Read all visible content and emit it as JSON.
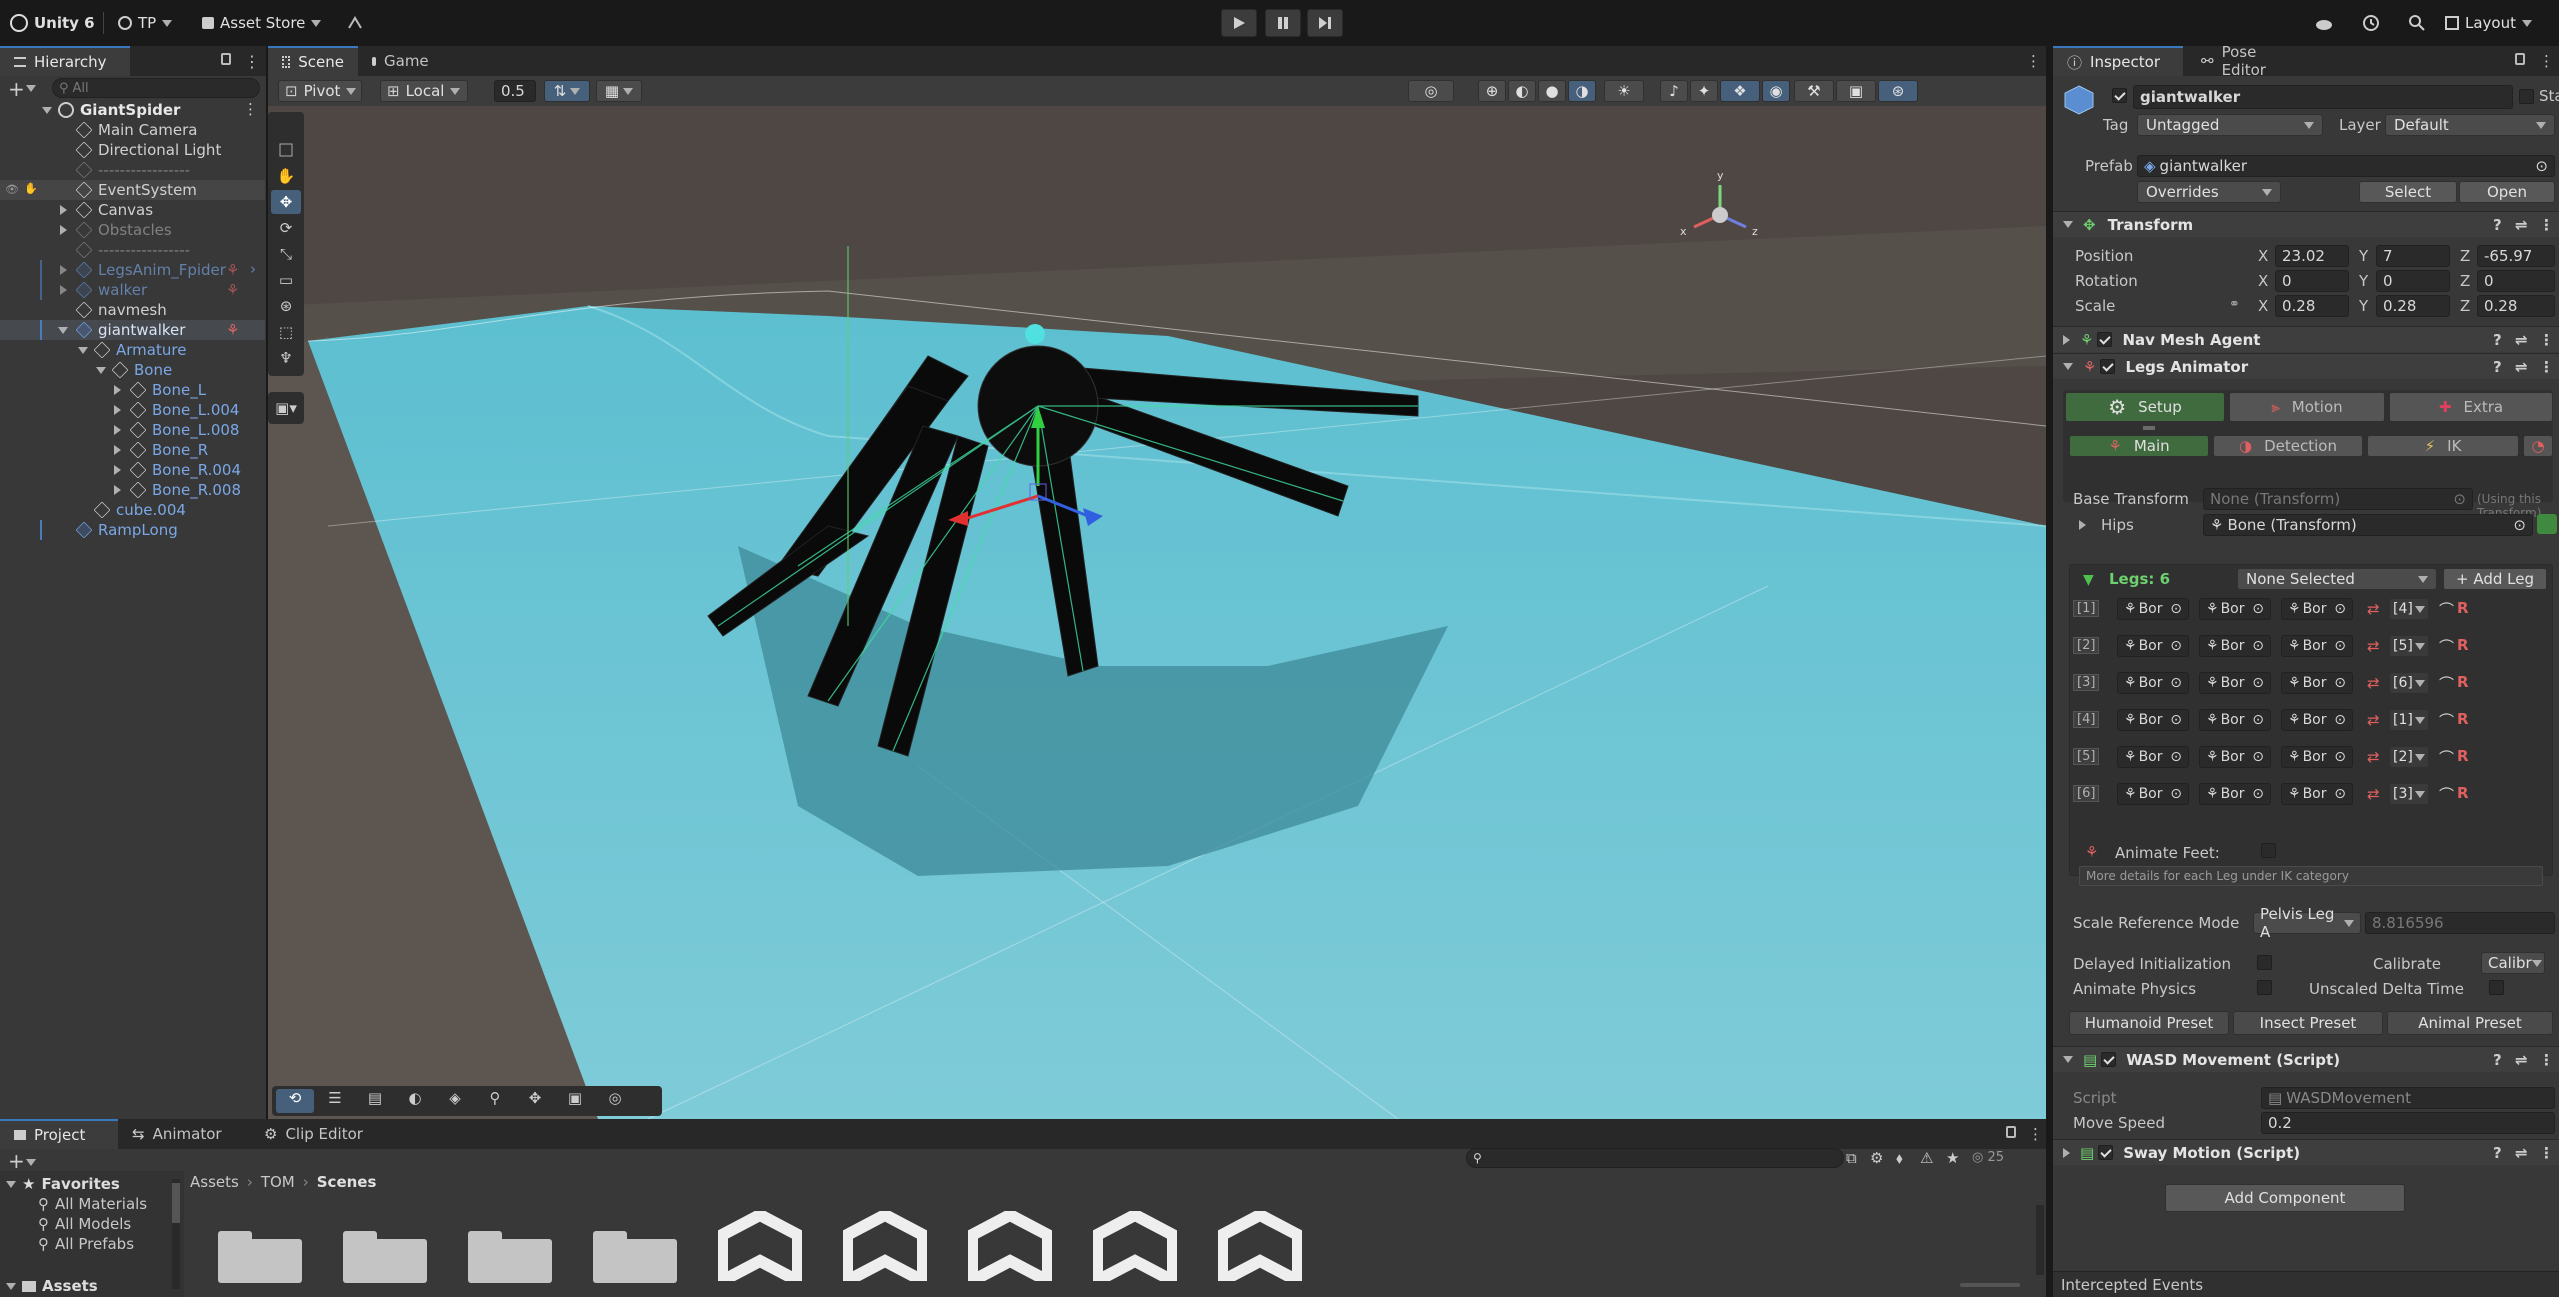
{
  "topbar": {
    "app_title": "Unity 6",
    "account": "TP",
    "asset_store": "Asset Store",
    "layout": "Layout"
  },
  "hierarchy": {
    "tab": "Hierarchy",
    "search_placeholder": "All",
    "scene": "GiantSpider",
    "items": [
      {
        "label": "Main Camera"
      },
      {
        "label": "Directional Light"
      },
      {
        "label": "-----------------"
      },
      {
        "label": "EventSystem"
      },
      {
        "label": "Canvas"
      },
      {
        "label": "Obstacles"
      },
      {
        "label": "-----------------"
      },
      {
        "label": "LegsAnim_Fpider"
      },
      {
        "label": "walker"
      },
      {
        "label": "navmesh"
      },
      {
        "label": "giantwalker"
      },
      {
        "label": "Armature"
      },
      {
        "label": "Bone"
      },
      {
        "label": "Bone_L"
      },
      {
        "label": "Bone_L.004"
      },
      {
        "label": "Bone_L.008"
      },
      {
        "label": "Bone_R"
      },
      {
        "label": "Bone_R.004"
      },
      {
        "label": "Bone_R.008"
      },
      {
        "label": "cube.004"
      },
      {
        "label": "RampLong"
      }
    ]
  },
  "scene_view": {
    "tab_scene": "Scene",
    "tab_game": "Game",
    "pivot": "Pivot",
    "local": "Local",
    "snap": "0.5"
  },
  "inspector": {
    "tab_inspector": "Inspector",
    "tab_pose": "Pose Editor",
    "object_name": "giantwalker",
    "static_label": "Static",
    "tag_label": "Tag",
    "tag_value": "Untagged",
    "layer_label": "Layer",
    "layer_value": "Default",
    "prefab_label": "Prefab",
    "prefab_value": "giantwalker",
    "overrides": "Overrides",
    "select": "Select",
    "open": "Open",
    "transform": {
      "title": "Transform",
      "position_label": "Position",
      "rotation_label": "Rotation",
      "scale_label": "Scale",
      "x": "X",
      "y": "Y",
      "z": "Z",
      "pos": [
        "23.02",
        "7",
        "-65.97"
      ],
      "rot": [
        "0",
        "0",
        "0"
      ],
      "scale": [
        "0.28",
        "0.28",
        "0.28"
      ]
    },
    "nav_mesh_agent": "Nav Mesh Agent",
    "legs_animator": {
      "title": "Legs Animator",
      "tab_setup": "Setup",
      "tab_motion": "Motion",
      "tab_extra": "Extra",
      "sub_main": "Main",
      "sub_detection": "Detection",
      "sub_ik": "IK",
      "base_transform_label": "Base Transform",
      "base_transform_value": "None (Transform)",
      "base_transform_hint": "(Using this Transform)",
      "hips_label": "Hips",
      "hips_value": "Bone (Transform)",
      "legs_count": "Legs: 6",
      "none_selected": "None Selected",
      "add_leg": "+ Add Leg",
      "legs": [
        {
          "idx": "[1]",
          "b1": "Bor",
          "b2": "Bor",
          "b3": "Bor",
          "opp": "[4]"
        },
        {
          "idx": "[2]",
          "b1": "Bor",
          "b2": "Bor",
          "b3": "Bor",
          "opp": "[5]"
        },
        {
          "idx": "[3]",
          "b1": "Bor",
          "b2": "Bor",
          "b3": "Bor",
          "opp": "[6]"
        },
        {
          "idx": "[4]",
          "b1": "Bor",
          "b2": "Bor",
          "b3": "Bor",
          "opp": "[1]"
        },
        {
          "idx": "[5]",
          "b1": "Bor",
          "b2": "Bor",
          "b3": "Bor",
          "opp": "[2]"
        },
        {
          "idx": "[6]",
          "b1": "Bor",
          "b2": "Bor",
          "b3": "Bor",
          "opp": "[3]"
        }
      ],
      "animate_feet": "Animate Feet:",
      "more_details": "More details for each Leg under IK category",
      "scale_ref_label": "Scale Reference Mode",
      "scale_ref_value": "Pelvis Leg A",
      "scale_ref_number": "8.816596",
      "delayed_init": "Delayed Initialization",
      "calibrate": "Calibrate",
      "calibrate_value": "Calibr",
      "animate_physics": "Animate Physics",
      "unscaled_delta": "Unscaled Delta Time",
      "preset_humanoid": "Humanoid Preset",
      "preset_insect": "Insect Preset",
      "preset_animal": "Animal Preset"
    },
    "wasd": {
      "title": "WASD Movement (Script)",
      "script_label": "Script",
      "script_value": "WASDMovement",
      "move_speed_label": "Move Speed",
      "move_speed_value": "0.2"
    },
    "sway": "Sway Motion (Script)",
    "add_component": "Add Component",
    "intercepted": "Intercepted Events"
  },
  "project": {
    "tab_project": "Project",
    "tab_animator": "Animator",
    "tab_clip": "Clip Editor",
    "favorites": "Favorites",
    "fav_items": [
      "All Materials",
      "All Models",
      "All Prefabs"
    ],
    "assets": "Assets",
    "breadcrumb": [
      "Assets",
      "TOM",
      "Scenes"
    ],
    "hidden_count": "25"
  },
  "colors": {
    "accent": "#3a79bb",
    "prefab_blue": "#7aa7e6",
    "green_tab": "#3f6b3f"
  }
}
